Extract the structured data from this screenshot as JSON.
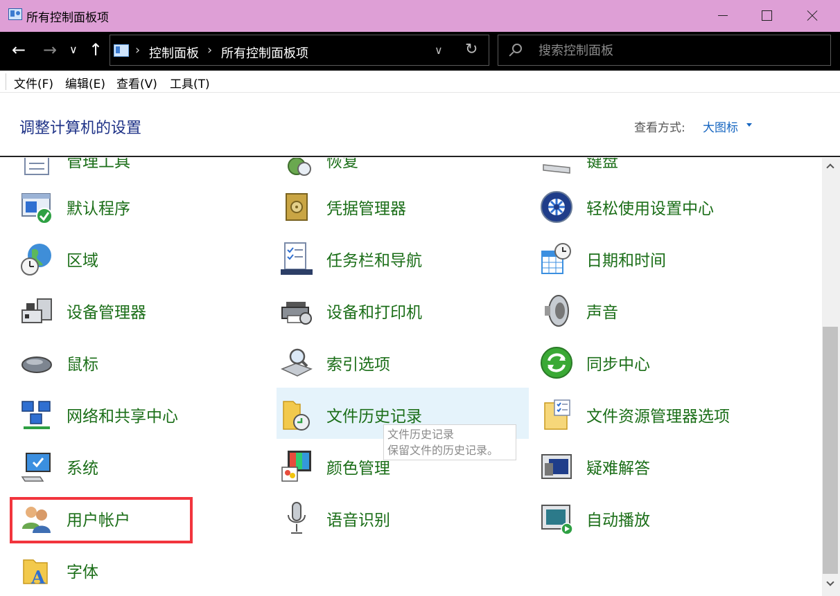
{
  "window": {
    "title": "所有控制面板项"
  },
  "nav": {
    "back": "←",
    "forward": "→",
    "recent": "∨",
    "up": "↑",
    "refresh": "↻"
  },
  "address": {
    "crumbs": [
      "控制面板",
      "所有控制面板项"
    ],
    "separator": "›"
  },
  "search": {
    "placeholder": "搜索控制面板"
  },
  "menu": {
    "items": [
      "文件(F)",
      "编辑(E)",
      "查看(V)",
      "工具(T)"
    ]
  },
  "header": {
    "title": "调整计算机的设置",
    "view_label": "查看方式:",
    "view_value": "大图标"
  },
  "items": {
    "partial": [
      "管理工具",
      "恢复",
      "键盘"
    ],
    "col1": [
      "默认程序",
      "区域",
      "设备管理器",
      "鼠标",
      "网络和共享中心",
      "系统",
      "用户帐户",
      "字体"
    ],
    "col2": [
      "凭据管理器",
      "任务栏和导航",
      "设备和打印机",
      "索引选项",
      "文件历史记录",
      "颜色管理",
      "语音识别"
    ],
    "col3": [
      "轻松使用设置中心",
      "日期和时间",
      "声音",
      "同步中心",
      "文件资源管理器选项",
      "疑难解答",
      "自动播放"
    ]
  },
  "tooltip": {
    "title": "文件历史记录",
    "description": "保留文件的历史记录。"
  },
  "colors": {
    "titlebar": "#de9fd6",
    "item_text": "#1b6e18",
    "header_title": "#1e3287",
    "link": "#1565c0",
    "highlight": "#f2353d",
    "hover": "#e5f3fb"
  }
}
